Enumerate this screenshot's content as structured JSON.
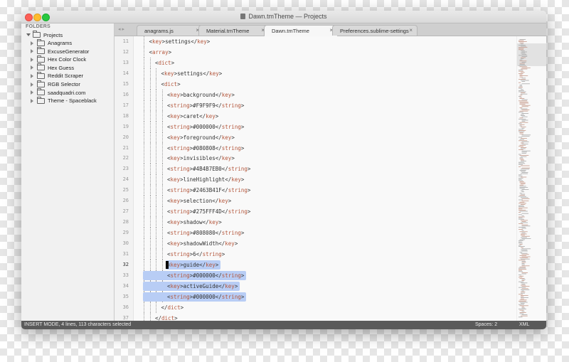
{
  "window": {
    "title": "Dawn.tmTheme — Projects"
  },
  "sidebar": {
    "header": "FOLDERS",
    "project": "Projects",
    "folders": [
      "Anagrams",
      "ExcuseGenerator",
      "Hex Color Clock",
      "Hex Guess",
      "Reddit Scraper",
      "RGB Selector",
      "saadquadri.com",
      "Theme - Spaceblack"
    ]
  },
  "tabs": [
    {
      "label": "anagrams.js",
      "close": "×"
    },
    {
      "label": "Material.tmTheme",
      "close": "×"
    },
    {
      "label": "Dawn.tmTheme",
      "close": "×"
    },
    {
      "label": "Preferences.sublime-settings",
      "close": "×"
    }
  ],
  "editor": {
    "lines": [
      {
        "n": "11",
        "indent": 1,
        "parts": [
          [
            "t",
            "<"
          ],
          [
            "k",
            "key"
          ],
          [
            "t",
            ">settings</"
          ],
          [
            "k",
            "key"
          ],
          [
            "t",
            ">"
          ]
        ]
      },
      {
        "n": "12",
        "indent": 1,
        "parts": [
          [
            "t",
            "<"
          ],
          [
            "k",
            "array"
          ],
          [
            "t",
            ">"
          ]
        ]
      },
      {
        "n": "13",
        "indent": 2,
        "parts": [
          [
            "t",
            "<"
          ],
          [
            "k",
            "dict"
          ],
          [
            "t",
            ">"
          ]
        ]
      },
      {
        "n": "14",
        "indent": 3,
        "parts": [
          [
            "t",
            "<"
          ],
          [
            "k",
            "key"
          ],
          [
            "t",
            ">settings</"
          ],
          [
            "k",
            "key"
          ],
          [
            "t",
            ">"
          ]
        ]
      },
      {
        "n": "15",
        "indent": 3,
        "parts": [
          [
            "t",
            "<"
          ],
          [
            "k",
            "dict"
          ],
          [
            "t",
            ">"
          ]
        ]
      },
      {
        "n": "16",
        "indent": 4,
        "parts": [
          [
            "t",
            "<"
          ],
          [
            "k",
            "key"
          ],
          [
            "t",
            ">background</"
          ],
          [
            "k",
            "key"
          ],
          [
            "t",
            ">"
          ]
        ]
      },
      {
        "n": "17",
        "indent": 4,
        "parts": [
          [
            "t",
            "<"
          ],
          [
            "k",
            "string"
          ],
          [
            "t",
            ">#F9F9F9</"
          ],
          [
            "k",
            "string"
          ],
          [
            "t",
            ">"
          ]
        ]
      },
      {
        "n": "18",
        "indent": 4,
        "parts": [
          [
            "t",
            "<"
          ],
          [
            "k",
            "key"
          ],
          [
            "t",
            ">caret</"
          ],
          [
            "k",
            "key"
          ],
          [
            "t",
            ">"
          ]
        ]
      },
      {
        "n": "19",
        "indent": 4,
        "parts": [
          [
            "t",
            "<"
          ],
          [
            "k",
            "string"
          ],
          [
            "t",
            ">#000000</"
          ],
          [
            "k",
            "string"
          ],
          [
            "t",
            ">"
          ]
        ]
      },
      {
        "n": "20",
        "indent": 4,
        "parts": [
          [
            "t",
            "<"
          ],
          [
            "k",
            "key"
          ],
          [
            "t",
            ">foreground</"
          ],
          [
            "k",
            "key"
          ],
          [
            "t",
            ">"
          ]
        ]
      },
      {
        "n": "21",
        "indent": 4,
        "parts": [
          [
            "t",
            "<"
          ],
          [
            "k",
            "string"
          ],
          [
            "t",
            ">#080808</"
          ],
          [
            "k",
            "string"
          ],
          [
            "t",
            ">"
          ]
        ]
      },
      {
        "n": "22",
        "indent": 4,
        "parts": [
          [
            "t",
            "<"
          ],
          [
            "k",
            "key"
          ],
          [
            "t",
            ">invisibles</"
          ],
          [
            "k",
            "key"
          ],
          [
            "t",
            ">"
          ]
        ]
      },
      {
        "n": "23",
        "indent": 4,
        "parts": [
          [
            "t",
            "<"
          ],
          [
            "k",
            "string"
          ],
          [
            "t",
            ">#4B4B7EB0</"
          ],
          [
            "k",
            "string"
          ],
          [
            "t",
            ">"
          ]
        ]
      },
      {
        "n": "24",
        "indent": 4,
        "parts": [
          [
            "t",
            "<"
          ],
          [
            "k",
            "key"
          ],
          [
            "t",
            ">lineHighlight</"
          ],
          [
            "k",
            "key"
          ],
          [
            "t",
            ">"
          ]
        ]
      },
      {
        "n": "25",
        "indent": 4,
        "parts": [
          [
            "t",
            "<"
          ],
          [
            "k",
            "string"
          ],
          [
            "t",
            ">#2463B41F</"
          ],
          [
            "k",
            "string"
          ],
          [
            "t",
            ">"
          ]
        ]
      },
      {
        "n": "26",
        "indent": 4,
        "parts": [
          [
            "t",
            "<"
          ],
          [
            "k",
            "key"
          ],
          [
            "t",
            ">selection</"
          ],
          [
            "k",
            "key"
          ],
          [
            "t",
            ">"
          ]
        ]
      },
      {
        "n": "27",
        "indent": 4,
        "parts": [
          [
            "t",
            "<"
          ],
          [
            "k",
            "string"
          ],
          [
            "t",
            ">#275FFF4D</"
          ],
          [
            "k",
            "string"
          ],
          [
            "t",
            ">"
          ]
        ]
      },
      {
        "n": "28",
        "indent": 4,
        "parts": [
          [
            "t",
            "<"
          ],
          [
            "k",
            "key"
          ],
          [
            "t",
            ">shadow</"
          ],
          [
            "k",
            "key"
          ],
          [
            "t",
            ">"
          ]
        ]
      },
      {
        "n": "29",
        "indent": 4,
        "parts": [
          [
            "t",
            "<"
          ],
          [
            "k",
            "string"
          ],
          [
            "t",
            ">#808080</"
          ],
          [
            "k",
            "string"
          ],
          [
            "t",
            ">"
          ]
        ]
      },
      {
        "n": "30",
        "indent": 4,
        "parts": [
          [
            "t",
            "<"
          ],
          [
            "k",
            "key"
          ],
          [
            "t",
            ">shadowWidth</"
          ],
          [
            "k",
            "key"
          ],
          [
            "t",
            ">"
          ]
        ]
      },
      {
        "n": "31",
        "indent": 4,
        "parts": [
          [
            "t",
            "<"
          ],
          [
            "k",
            "string"
          ],
          [
            "t",
            ">6</"
          ],
          [
            "k",
            "string"
          ],
          [
            "t",
            ">"
          ]
        ]
      },
      {
        "n": "32",
        "indent": 4,
        "parts": [
          [
            "t",
            "<"
          ],
          [
            "k",
            "key"
          ],
          [
            "t",
            ">guide</"
          ],
          [
            "k",
            "key"
          ],
          [
            "t",
            ">"
          ]
        ]
      },
      {
        "n": "33",
        "indent": 4,
        "parts": [
          [
            "t",
            "<"
          ],
          [
            "k",
            "string"
          ],
          [
            "t",
            ">#000000</"
          ],
          [
            "k",
            "string"
          ],
          [
            "t",
            ">"
          ]
        ]
      },
      {
        "n": "34",
        "indent": 4,
        "parts": [
          [
            "t",
            "<"
          ],
          [
            "k",
            "key"
          ],
          [
            "t",
            ">activeGuide</"
          ],
          [
            "k",
            "key"
          ],
          [
            "t",
            ">"
          ]
        ]
      },
      {
        "n": "35",
        "indent": 4,
        "parts": [
          [
            "t",
            "<"
          ],
          [
            "k",
            "string"
          ],
          [
            "t",
            ">#000000</"
          ],
          [
            "k",
            "string"
          ],
          [
            "t",
            ">"
          ]
        ]
      },
      {
        "n": "36",
        "indent": 3,
        "parts": [
          [
            "t",
            "</"
          ],
          [
            "k",
            "dict"
          ],
          [
            "t",
            ">"
          ]
        ]
      },
      {
        "n": "37",
        "indent": 2,
        "parts": [
          [
            "t",
            "</"
          ],
          [
            "k",
            "dict"
          ],
          [
            "t",
            ">"
          ]
        ]
      }
    ],
    "selection_start_line": 21,
    "selection_end_line": 24,
    "colors": {
      "tag": "#b3553a",
      "selection": "#b8cdf5",
      "background": "#F9F9F9"
    }
  },
  "status": {
    "left": "INSERT MODE, 4 lines, 113 characters selected",
    "spaces": "Spaces: 2",
    "syntax": "XML"
  }
}
